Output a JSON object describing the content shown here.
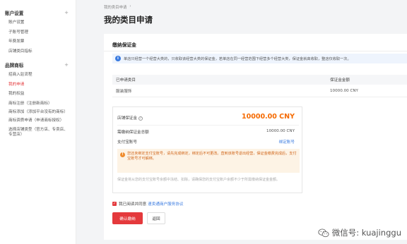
{
  "sidebar": {
    "sections": [
      {
        "title": "账户设置",
        "toggle": "+",
        "items": [
          {
            "label": "账户设置"
          },
          {
            "label": "子账号管理"
          },
          {
            "label": "年费发票"
          },
          {
            "label": "店铺类目指标"
          }
        ]
      },
      {
        "title": "品牌商标",
        "toggle": "+",
        "items": [
          {
            "label": "招商入驻流程"
          },
          {
            "label": "我的申请",
            "active": true
          },
          {
            "label": "我的权益"
          },
          {
            "label": "商标注册（注册新商标）"
          },
          {
            "label": "商标添加（添加平台没有的商标）"
          },
          {
            "label": "商标资质申请（申请商标授权）"
          },
          {
            "label": "选择店铺类型（官方店、专卖店、专营店）"
          }
        ]
      }
    ]
  },
  "breadcrumb": {
    "item": "我的类目申请",
    "separator": "›"
  },
  "page_title": "我的类目申请",
  "card": {
    "title": "缴纳保证金",
    "notice": "单店只经营一个经营大类的，只收取该经营大类的保证金，若单店在同一经营范围下经营多个经营大类，保证金就高收取，整店仅收取一次。"
  },
  "table": {
    "headers": [
      "已申请类目",
      "保证金金额"
    ],
    "rows": [
      {
        "category": "服装服饰",
        "amount": "10000.00  CNY"
      }
    ]
  },
  "summary": {
    "deposit_label": "店铺保证金",
    "deposit_help": "?",
    "deposit_amount": "10000.00 CNY",
    "total_label": "需缴纳保证金总额",
    "total_amount": "10000.00 CNY",
    "alipay_label": "支付宝账号",
    "bind_link": "绑定账号",
    "warning": "您还未绑定支付宝账号，请先完成绑定，绑定后不可更改。直到该账号退出经营，保证金缴费完成后，支付宝账号才可解绑。",
    "footnote": "保证金将从您的支付宝账号余额中冻结、扣除，请确保您的支付宝账户余额不少于所需缴纳保证金金额。"
  },
  "agreement": {
    "text": "我已阅读并同意",
    "link": "速卖通商户服务协议"
  },
  "buttons": {
    "confirm": "确认缴纳",
    "back": "返回"
  },
  "watermark": {
    "text": "微信号: kuajinggu"
  }
}
